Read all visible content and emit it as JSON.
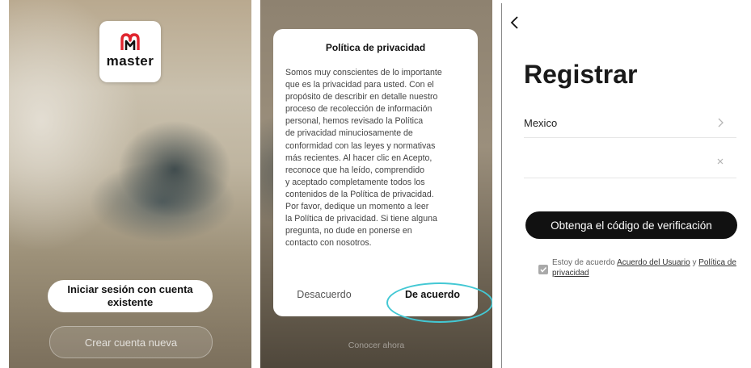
{
  "welcome": {
    "logo_text": "master",
    "login_button": "Iniciar sesión con cuenta existente",
    "create_button": "Crear cuenta nueva",
    "brand_color": "#e0252f"
  },
  "privacy": {
    "title": "Política de privacidad",
    "body_lines": [
      "Somos muy conscientes de lo importante",
      "que es la privacidad para usted. Con el",
      "propósito de describir en detalle nuestro",
      "proceso de recolección de información",
      "personal, hemos revisado la Política",
      "de privacidad minuciosamente de",
      "conformidad con las leyes y normativas",
      "más recientes. Al hacer clic en Acepto,",
      "reconoce que ha leído, comprendido",
      "y aceptado completamente todos los",
      "contenidos de la Política de privacidad.",
      "Por favor, dedique un momento a leer",
      "la Política de privacidad. Si tiene alguna",
      "pregunta, no dude en ponerse en",
      "contacto con nosotros."
    ],
    "disagree_button": "Desacuerdo",
    "agree_button": "De acuerdo",
    "background_link": "Conocer ahora",
    "highlight_color": "#43c8d4"
  },
  "register": {
    "back_icon": "chevron-left-icon",
    "title": "Registrar",
    "country_value": "Mexico",
    "phone_value": "",
    "code_button": "Obtenga el código de verificación",
    "agree_prefix": "Estoy de acuerdo ",
    "user_agreement_link": "Acuerdo del Usuario",
    "and_text": " y ",
    "privacy_link": "Política de privacidad",
    "checkbox_checked": true
  }
}
